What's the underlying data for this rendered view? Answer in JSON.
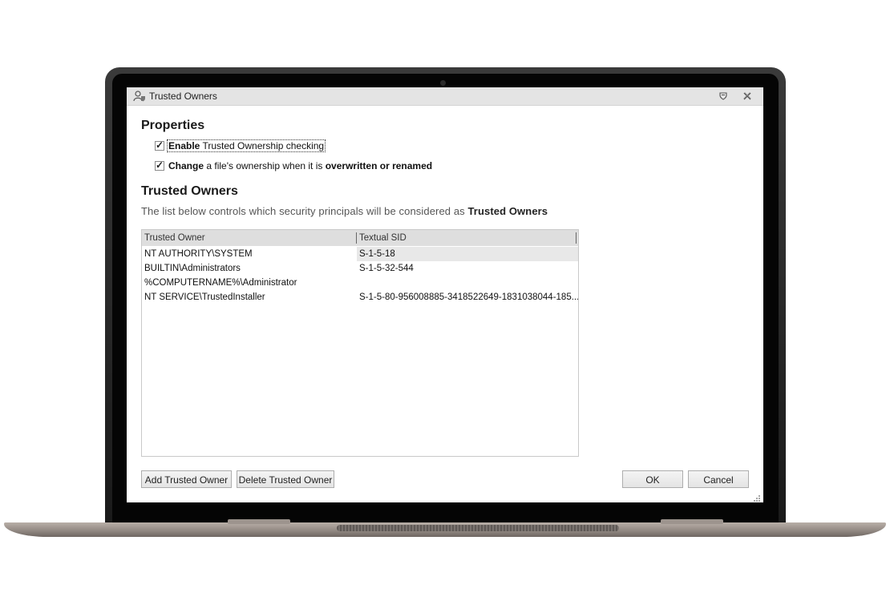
{
  "window": {
    "title": "Trusted Owners",
    "icon": "trusted-owner-icon",
    "help_icon": "help-icon",
    "close_icon": "close-icon"
  },
  "properties": {
    "heading": "Properties",
    "checkbox1": {
      "checked": true,
      "bold": "Enable",
      "text": " Trusted Ownership checking"
    },
    "checkbox2": {
      "checked": true,
      "bold": "Change",
      "text": " a file's ownership when it is ",
      "bold2": "overwritten or renamed"
    }
  },
  "trusted_owners": {
    "heading": "Trusted Owners",
    "description_prefix": "The list below controls which security principals will be considered as ",
    "description_bold": "Trusted Owners"
  },
  "table": {
    "columns": [
      "Trusted Owner",
      "Textual SID"
    ],
    "rows": [
      {
        "owner": "NT AUTHORITY\\SYSTEM",
        "sid": "S-1-5-18"
      },
      {
        "owner": "BUILTIN\\Administrators",
        "sid": "S-1-5-32-544"
      },
      {
        "owner": "%COMPUTERNAME%\\Administrator",
        "sid": ""
      },
      {
        "owner": "NT SERVICE\\TrustedInstaller",
        "sid": "S-1-5-80-956008885-3418522649-1831038044-185..."
      }
    ]
  },
  "buttons": {
    "add": "Add Trusted Owner",
    "delete": "Delete Trusted Owner",
    "ok": "OK",
    "cancel": "Cancel"
  }
}
